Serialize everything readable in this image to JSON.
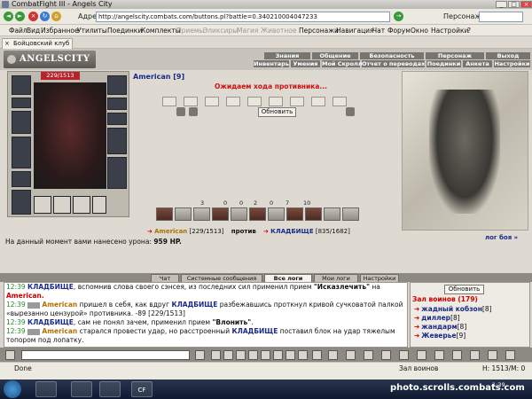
{
  "window": {
    "title": "CombatFight III - Angels City"
  },
  "address": {
    "label": "Адрес:",
    "url": "http://angelscity.combats.com/buttons.pl?battle=0.340210004047233",
    "go_label": "→",
    "persona_label": "Персонаж:"
  },
  "menu": {
    "items": [
      "Файл",
      "Вид",
      "Избранное",
      "Утилиты",
      "Поединки",
      "Комплекты",
      "Приемы",
      "Эликсиры",
      "Магия",
      "Животное",
      "Персонажи",
      "Навигация",
      "Чат",
      "Форум",
      "Окно",
      "Настройки",
      "?"
    ]
  },
  "tab": {
    "label": "Бойцовский клуб"
  },
  "game_nav": {
    "row1": [
      "Знания",
      "Общение",
      "Безопасность",
      "Персонаж",
      "Выход"
    ],
    "row2": [
      "Инвентарь",
      "Умения",
      "Мой Скролл",
      "Отчет о переводах",
      "Поединки",
      "Анкета",
      "Настройки"
    ],
    "logo": "ANGELSCITY"
  },
  "player": {
    "hp": "229/1513",
    "name": "American [9]"
  },
  "battle": {
    "waiting_message": "Ожидаем хода противника...",
    "refresh_label": "Обновить",
    "stats": [
      "3",
      "0",
      "0",
      "2",
      "0",
      "7",
      "10"
    ],
    "versus": {
      "player": "American",
      "player_hp": "[229/1513]",
      "word": "против",
      "enemy": "КЛАДБИЩЕ",
      "enemy_hp": "[835/1682]"
    },
    "damage_prefix": "На данный момент вами нанесено урона:",
    "damage_value": "959 HP.",
    "log_link": "лог боя »"
  },
  "chat": {
    "tabs": [
      "Чат",
      "Системные сообщения",
      "Все логи",
      "Мои логи",
      "Настройки"
    ],
    "active_tab": "Все логи",
    "lines": [
      {
        "time": "12:39",
        "name": "КЛАДБИЩЕ",
        "text": ", вспомнив слова своего сэнсея, из последних сил применил прием ",
        "bold": "\"Исказлечить\"",
        "tail": " на "
      },
      {
        "time": "",
        "name": "",
        "text": "",
        "bold": "",
        "tail": "American."
      },
      {
        "time": "12:39",
        "name": "American",
        "text": " пришел в себя, как вдруг ",
        "bold": "КЛАДБИЩЕ",
        "tail": " разбежавшись проткнул кривой сучковатой палкой «вырезанно цензурой» противника. -89 [229/1513]"
      },
      {
        "time": "12:39",
        "name": "КЛАДБИЩЕ",
        "text": ", сам не понял зачем, применил прием ",
        "bold": "\"Влонить\"",
        "tail": "."
      },
      {
        "time": "12:39",
        "name": "American",
        "text": " старался провести удар, но расстроенный ",
        "bold": "КЛАДБИЩЕ",
        "tail": " поставил блок на удар тяжелым топором под лопатку."
      }
    ]
  },
  "room": {
    "refresh_label": "Обновить",
    "title": "Зал воинов (179)",
    "users": [
      {
        "name": "жадный кобзон",
        "level": "[8]"
      },
      {
        "name": "диллер",
        "level": "[8]"
      },
      {
        "name": "жандарм",
        "level": "[8]"
      },
      {
        "name": "Жеверьe",
        "level": "[9]"
      }
    ]
  },
  "status": {
    "done": "Done",
    "room": "Зал воинов",
    "hp": "H: 1513/M: 0"
  },
  "taskbar": {
    "app_label": "CF",
    "time": "1:39"
  },
  "watermark": "photo.scrolls.combats.com"
}
